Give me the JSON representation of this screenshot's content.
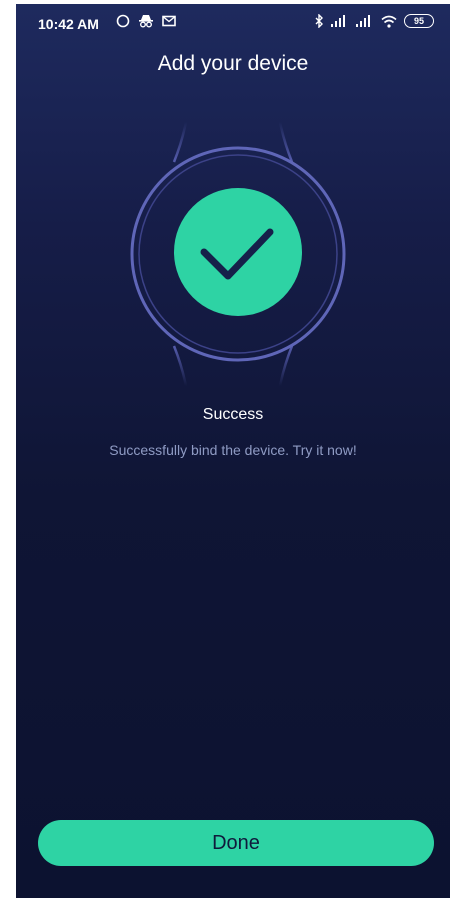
{
  "status_bar": {
    "time": "10:42 AM",
    "battery": "95",
    "icons": [
      "sync-icon",
      "incognito-icon",
      "mail-icon",
      "bluetooth-icon",
      "signal-icon",
      "signal-icon",
      "wifi-icon",
      "battery-icon"
    ]
  },
  "header": {
    "title": "Add your device"
  },
  "result": {
    "title": "Success",
    "message": "Successfully bind the device. Try it now!",
    "icon": "checkmark-icon",
    "accent_color": "#2ed3a4"
  },
  "actions": {
    "done_label": "Done"
  }
}
